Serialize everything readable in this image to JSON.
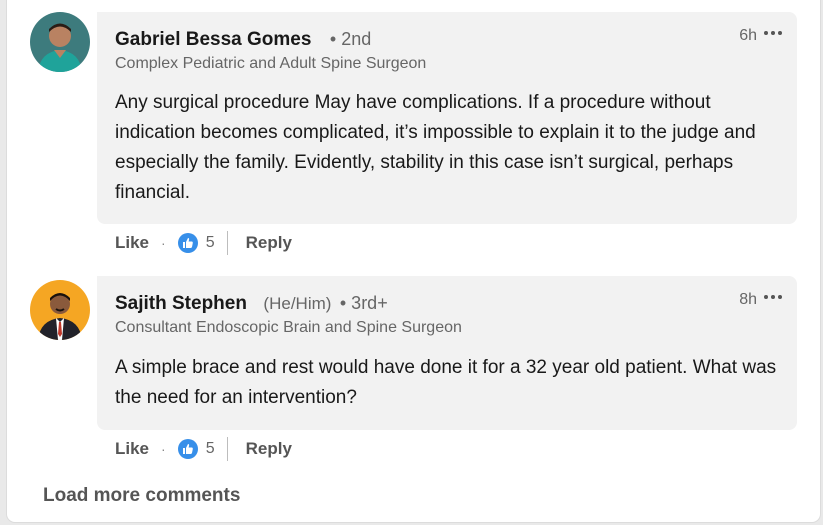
{
  "comments": [
    {
      "name": "Gabriel Bessa Gomes",
      "pronouns": "",
      "degree": "• 2nd",
      "headline": "Complex Pediatric and Adult Spine Surgeon",
      "time": "6h",
      "text": "Any surgical procedure May have complications. If a procedure without indication becomes complicated, it’s impossible to explain it to the judge and especially the family. Evidently, stability in this case isn’t surgical, perhaps financial.",
      "like_label": "Like",
      "separator": "·",
      "reaction_count": "5",
      "reply_label": "Reply",
      "icon": "thumbs-up-icon"
    },
    {
      "name": "Sajith Stephen",
      "pronouns": "(He/Him)",
      "degree": "• 3rd+",
      "headline": "Consultant Endoscopic Brain and Spine Surgeon",
      "time": "8h",
      "text": "A simple brace and rest would have done it for a 32 year old patient. What was the need for an intervention?",
      "like_label": "Like",
      "separator": "·",
      "reaction_count": "5",
      "reply_label": "Reply",
      "icon": "thumbs-up-icon"
    }
  ],
  "load_more_label": "Load more comments",
  "colors": {
    "accent": "#378fe9",
    "bubble": "#f2f2f2",
    "muted": "#666666"
  }
}
